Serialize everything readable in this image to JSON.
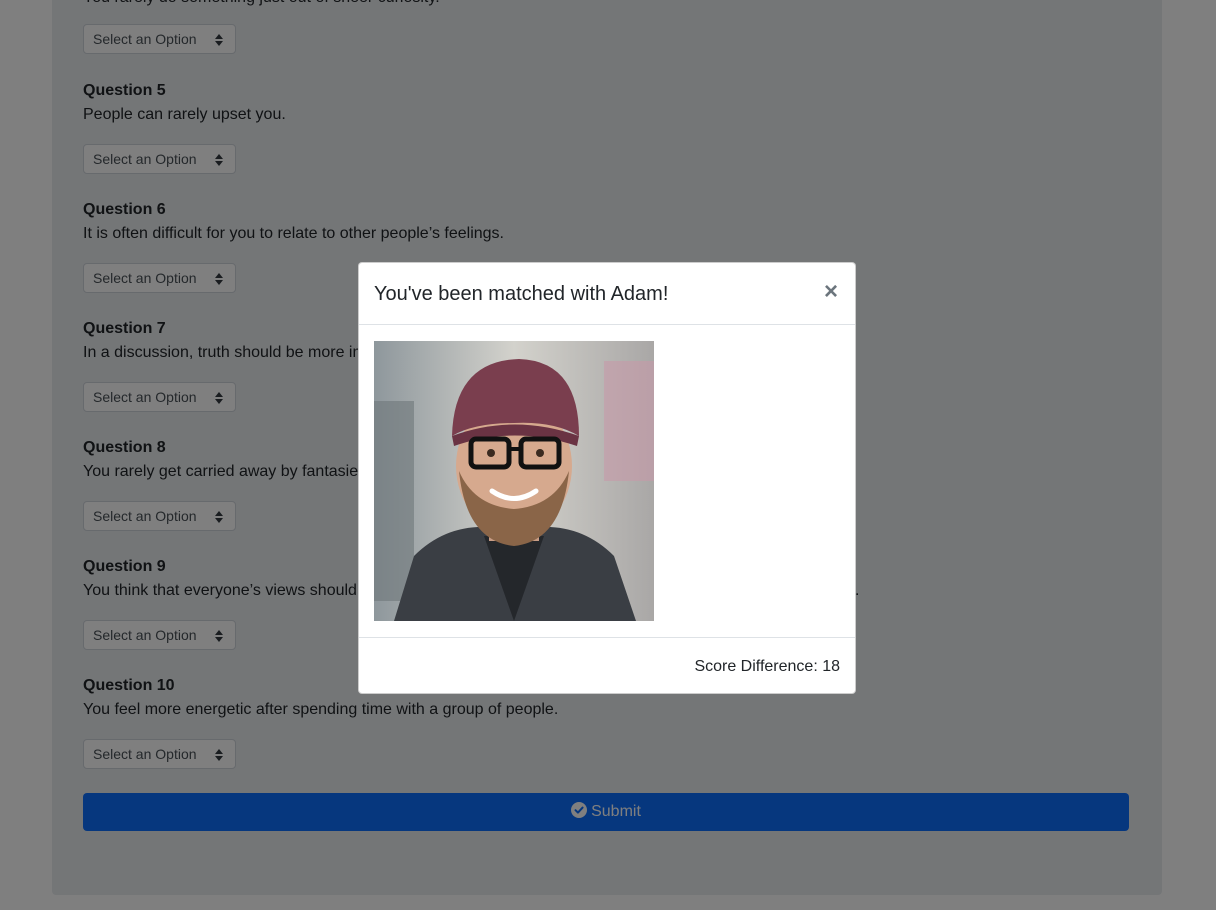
{
  "questions": [
    {
      "title": "",
      "text": "You rarely do something just out of sheer curiosity.",
      "select": "Select an Option"
    },
    {
      "title": "Question 5",
      "text": "People can rarely upset you.",
      "select": "Select an Option"
    },
    {
      "title": "Question 6",
      "text": "It is often difficult for you to relate to other people’s feelings.",
      "select": "Select an Option"
    },
    {
      "title": "Question 7",
      "text": "In a discussion, truth should be more important than people’s sensitivities.",
      "select": "Select an Option"
    },
    {
      "title": "Question 8",
      "text": "You rarely get carried away by fantasies and ideas.",
      "select": "Select an Option"
    },
    {
      "title": "Question 9",
      "text": "You think that everyone’s views should be respected regardless of whether they are supported by facts or not.",
      "select": "Select an Option"
    },
    {
      "title": "Question 10",
      "text": "You feel more energetic after spending time with a group of people.",
      "select": "Select an Option"
    }
  ],
  "submit": {
    "label": "Submit",
    "icon": "check-circle-icon"
  },
  "modal": {
    "title": "You've been matched with Adam!",
    "close_label": "×",
    "score_text": "Score Difference: 18"
  },
  "colors": {
    "primary": "#0d6efd",
    "overlay": "rgba(0,0,0,0.5)"
  }
}
